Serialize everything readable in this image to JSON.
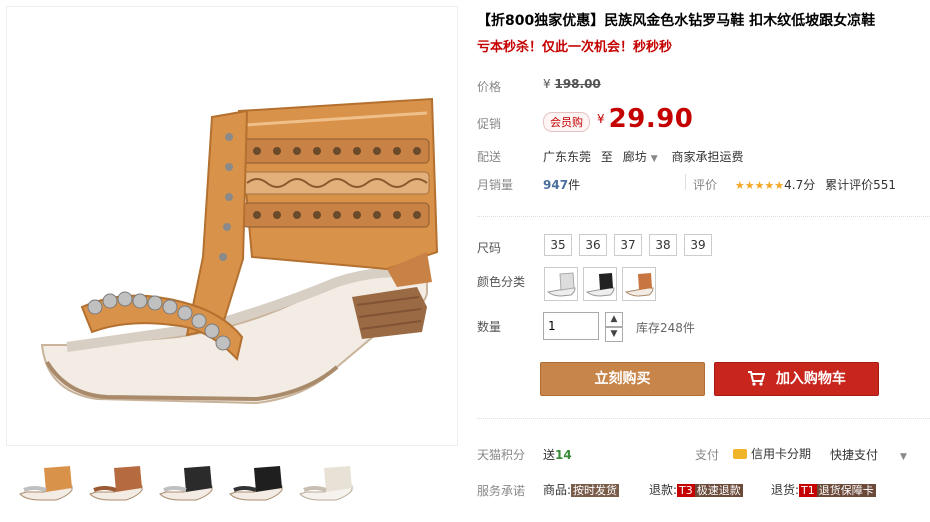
{
  "product": {
    "title": "【折800独家优惠】民族风金色水钻罗马鞋 扣木纹低坡跟女凉鞋",
    "subtitle": "亏本秒杀！仅此一次机会！秒秒秒"
  },
  "price": {
    "label": "价格",
    "currency": "¥",
    "original": "198.00"
  },
  "promo": {
    "label": "促销",
    "badge": "会员购",
    "currency": "¥",
    "value": "29.90"
  },
  "shipping": {
    "label": "配送",
    "from": "广东东莞",
    "to_word": "至",
    "destination": "廊坊",
    "fee_note": "商家承担运费"
  },
  "sales": {
    "label": "月销量",
    "count": "947",
    "unit": "件",
    "rating_label": "评价",
    "stars": "★★★★★",
    "score": "4.7分",
    "cumulative": "累计评价551"
  },
  "size": {
    "label": "尺码",
    "options": [
      "35",
      "36",
      "37",
      "38",
      "39"
    ]
  },
  "color": {
    "label": "颜色分类"
  },
  "quantity": {
    "label": "数量",
    "value": "1",
    "stock": "库存248件"
  },
  "buttons": {
    "buy_now": "立刻购买",
    "add_cart": "加入购物车"
  },
  "points": {
    "label": "天猫积分",
    "prefix": "送",
    "value": "14"
  },
  "payment": {
    "label": "支付",
    "credit": "信用卡分期",
    "quick": "快捷支付"
  },
  "service": {
    "label": "服务承诺",
    "goods_prefix": "商品:",
    "goods_tag": "按时发货",
    "refund_prefix": "退款:",
    "refund_code": "T3",
    "refund_tag": "极速退款",
    "return_prefix": "退货:",
    "return_code": "T1",
    "return_tag": "退货保障卡"
  },
  "colors": {
    "accent_red": "#c40000",
    "buy_button": "#c8854a",
    "cart_button": "#c8251c",
    "star": "#f5a623"
  }
}
